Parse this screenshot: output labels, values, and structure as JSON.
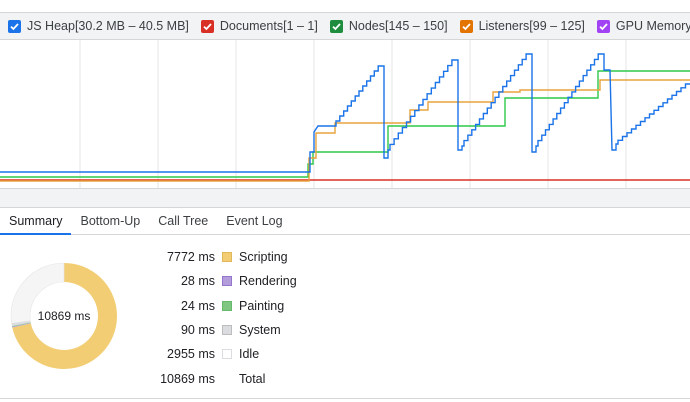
{
  "legend": {
    "items": [
      {
        "name": "js-heap",
        "label": "JS Heap[30.2 MB – 40.5 MB]",
        "color": "#1a73e8",
        "checked": true
      },
      {
        "name": "documents",
        "label": "Documents[1 – 1]",
        "color": "#d93025",
        "checked": true
      },
      {
        "name": "nodes",
        "label": "Nodes[145 – 150]",
        "color": "#1e8e3e",
        "checked": true
      },
      {
        "name": "listeners",
        "label": "Listeners[99 – 125]",
        "color": "#e37400",
        "checked": true
      },
      {
        "name": "gpu-memory",
        "label": "GPU Memory",
        "color": "#a142f4",
        "checked": true
      }
    ]
  },
  "graph": {
    "line_colors": {
      "js_heap": "#1a73e8",
      "documents": "#d93025",
      "nodes": "#2ec94a",
      "listeners": "#e8a33d"
    }
  },
  "tabs": [
    {
      "label": "Summary",
      "active": true
    },
    {
      "label": "Bottom-Up",
      "active": false
    },
    {
      "label": "Call Tree",
      "active": false
    },
    {
      "label": "Event Log",
      "active": false
    }
  ],
  "summary": {
    "total_label": "10869 ms",
    "rows": [
      {
        "value": "7772 ms",
        "label": "Scripting",
        "color": "#f2cd73",
        "border": "#e1b95a"
      },
      {
        "value": "28 ms",
        "label": "Rendering",
        "color": "#b39ddb",
        "border": "#9575cd"
      },
      {
        "value": "24 ms",
        "label": "Painting",
        "color": "#81c784",
        "border": "#66bb6a"
      },
      {
        "value": "90 ms",
        "label": "System",
        "color": "#dadce0",
        "border": "#bdbdbd"
      },
      {
        "value": "2955 ms",
        "label": "Idle",
        "color": "#ffffff",
        "border": "#dadce0"
      },
      {
        "value": "10869 ms",
        "label": "Total",
        "color": "",
        "border": ""
      }
    ]
  },
  "donut_segments": [
    {
      "label": "Scripting",
      "fraction": 0.7151,
      "color": "#f2cd73"
    },
    {
      "label": "Rendering",
      "fraction": 0.0026,
      "color": "#b39ddb"
    },
    {
      "label": "Painting",
      "fraction": 0.0022,
      "color": "#81c784"
    },
    {
      "label": "System",
      "fraction": 0.0083,
      "color": "#dadce0"
    },
    {
      "label": "Idle",
      "fraction": 0.2718,
      "color": "#f5f5f5"
    }
  ]
}
